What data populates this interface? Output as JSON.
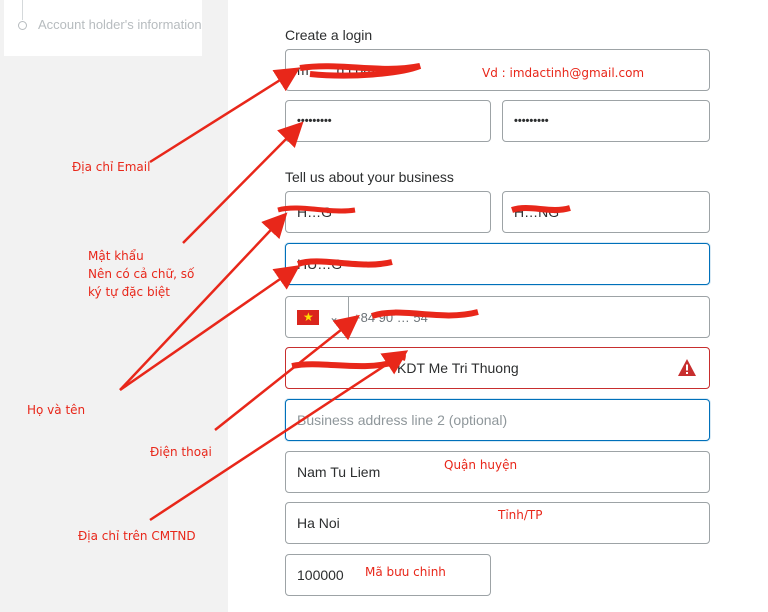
{
  "sidebar": {
    "step_label": "Account holder's information"
  },
  "login": {
    "section_label": "Create a login",
    "email_value": "m……g.com",
    "password_value": "•••••••••",
    "confirm_password_value": "•••••••••"
  },
  "business": {
    "section_label": "Tell us about your business",
    "first_name_value": "H…G",
    "last_name_value": "H…NG",
    "business_name_value": "HU…G",
    "phone_country_flag": "vietnam-flag-icon",
    "phone_value": "+84 90 … 54",
    "address_line1_value": "KDT Me Tri Thuong",
    "address_line2_placeholder": "Business address line 2 (optional)",
    "district_value": "Nam Tu Liem",
    "city_value": "Ha Noi",
    "postal_value": "100000"
  },
  "annotations": {
    "email_example": "Vd : imdactinh@gmail.com",
    "email_label": "Địa chỉ Email",
    "password_label": "Mật khẩu\nNên có cả chữ, số\nký tự đặc biệt",
    "name_label": "Họ và tên",
    "phone_label": "Điện thoại",
    "address_label": "Địa chỉ trên CMTND",
    "district_label": "Quận huyện",
    "city_label": "Tỉnh/TP",
    "postal_label": "Mã bưu chinh"
  },
  "colors": {
    "annotation_red": "#e8271a",
    "focus_blue": "#0070ba",
    "error_red": "#c72e2e",
    "warning_icon": "#c72e2e"
  }
}
